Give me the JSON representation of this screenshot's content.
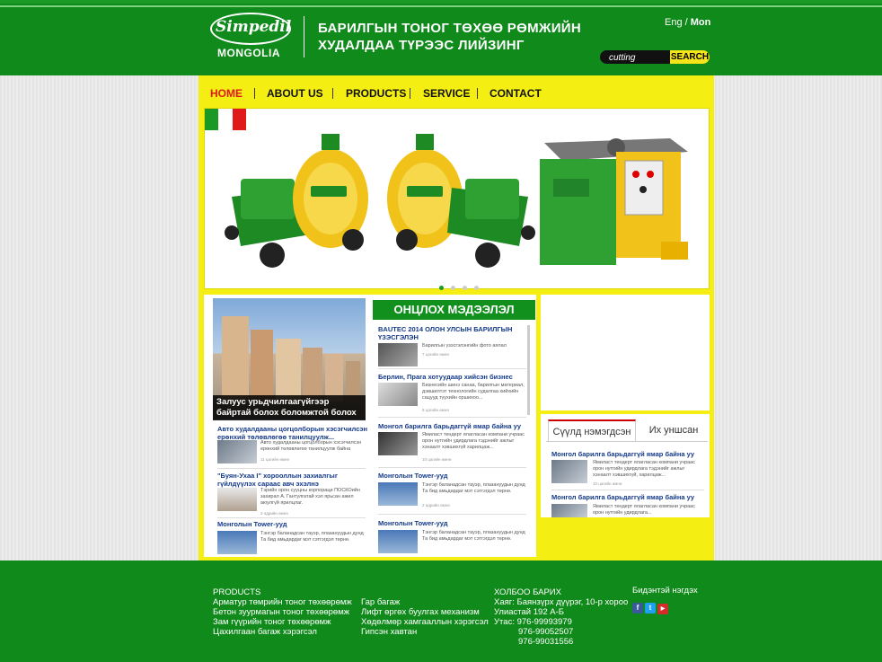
{
  "header": {
    "logo_text": "Simpedil",
    "logo_sub": "MONGOLIA",
    "tagline_line1": "БАРИЛГЫН ТОНОГ ТӨХӨӨ РӨМЖИЙН",
    "tagline_line2": "ХУДАЛДАА ТҮРЭЭС ЛИЙЗИНГ",
    "lang_en": "Eng",
    "lang_sep": "/",
    "lang_mn": "Mon",
    "search_value": "cutting",
    "search_button": "SEARCH"
  },
  "nav": {
    "items": [
      "HOME",
      "ABOUT US",
      "PRODUCTS",
      "SERVICE",
      "CONTACT"
    ]
  },
  "slider": {
    "flag_colors": [
      "#1a9a24",
      "#ffffff",
      "#e01a1a"
    ],
    "active_dot": 0,
    "dot_count": 4
  },
  "feature": {
    "caption": "Залуус урьдчилгаагүйгээр байртай болох боломжтой болох нь"
  },
  "news_header": "ОНЦЛОХ МЭДЭЭЛЭЛ",
  "left_news": [
    {
      "title": "Авто худалдааны цогцолборын хэсэгчилсэн ерөнхий төлөвлөгөө танилцуулж...",
      "text": "Авто худалдааны цогцолборын хэсэгчилсэн ерөнхий төлөвлөгөө танилцуулж байна",
      "date": "11 цагийн өмнө"
    },
    {
      "title": "\"Буян-Ухаа I\" хорооллын захиалгыг гүйлдүүлэх сараас авч эхэлнэ",
      "text": "Тэрийн орон сууцны корпораци ПОСКОийн захирал А. Гантулгатай хэл ярьсан ажил аюулгүй ярилцлаг.",
      "date": "3 өдрийн өмнө"
    },
    {
      "title": "Монголын Tower-ууд",
      "text": "Тэнгэр баланадсан тауэр, плазануудын дунд Та бид амьдардаг мэт сэтгэгдэл төрнө.",
      "date": ""
    }
  ],
  "right_news": [
    {
      "title": "BAUTEC 2014 ОЛОН УЛСЫН БАРИЛГЫН ҮЗЭСГЭЛЭН",
      "text": "Барилгын үзэсгэлэнгийн фото аялал",
      "date": "7 цагийн өмнө"
    },
    {
      "title": "Берлин, Прага хотуудаар хийсэн бизнес аялал",
      "text": "Бизнесийн шинэ санаа, барилгын материал, дэвшилтэт технологийн судалгаа хийхийн сацууд түүхийн оршихоо...",
      "date": "8 цагийн өмнө"
    },
    {
      "title": "Монгол барилга барьдаггүй ямар байна уу",
      "text": "Ямиласт тендерт ялагласан компани учраас орон нутгийн удирдлага тэдэнийг ажлыг хэнаалт хэвшихгүй харилцаж...",
      "date": "10 цагийн өмнө"
    },
    {
      "title": "Монголын Tower-ууд",
      "text": "Тэнгэр баланадсан тауэр, плазануудын дунд Та бид амьдардаг мэт сэтгэгдэл төрнө.",
      "date": "2 өдрийн өмнө"
    },
    {
      "title": "Монголын Tower-ууд",
      "text": "Тэнгэр баланадсан тауэр, плазануудын дунд Та бид амьдардаг мэт сэтгэгдэл төрнө.",
      "date": ""
    }
  ],
  "tabs": [
    "Сүүлд нэмэгдсэн",
    "Их уншсан"
  ],
  "tab_news": [
    {
      "title": "Монгол барилга барьдаггүй ямар байна уу",
      "text": "Ямиласт тендерт ялагласан компани учраас орон нутгийн удирдлага тэдэнийг ажлыг хэнаалт хэвшихгүй, харилцаж...",
      "date": "10 цагийн өмнө"
    },
    {
      "title": "Монгол барилга барьдаггүй ямар байна уу",
      "text": "Ямиласт тендерт ялагласан компани учраас орон нутгийн удирдлага...",
      "date": ""
    }
  ],
  "footer": {
    "products_title": "PRODUCTS",
    "products_col1": [
      "Арматур төмрийн тоног төхөөрөмж",
      "Бетон зуурмагын тоног төхөөрөмж",
      "Зам гүүрийн тоног төхөөрөмж",
      "Цахилгаан багаж хэрэгсэл"
    ],
    "products_col2": [
      "Гар багаж",
      "Лифт өргөх буулгах механизм",
      "Хөдөлмөр хамгааллын хэрэгсэл",
      "Гипсэн хавтан"
    ],
    "contact_title": "ХОЛБОО БАРИХ",
    "contact_lines": [
      "Хаяг: Баянзүрх дүүрэг, 10-р хороо",
      "Улиастай 192 А-Б",
      "Утас: 976-99993979",
      "976-99052507",
      "976-99031556"
    ],
    "social_title": "Бидэнтэй нэгдэх",
    "social_icons": [
      "facebook-icon",
      "twitter-icon",
      "youtube-icon"
    ]
  }
}
